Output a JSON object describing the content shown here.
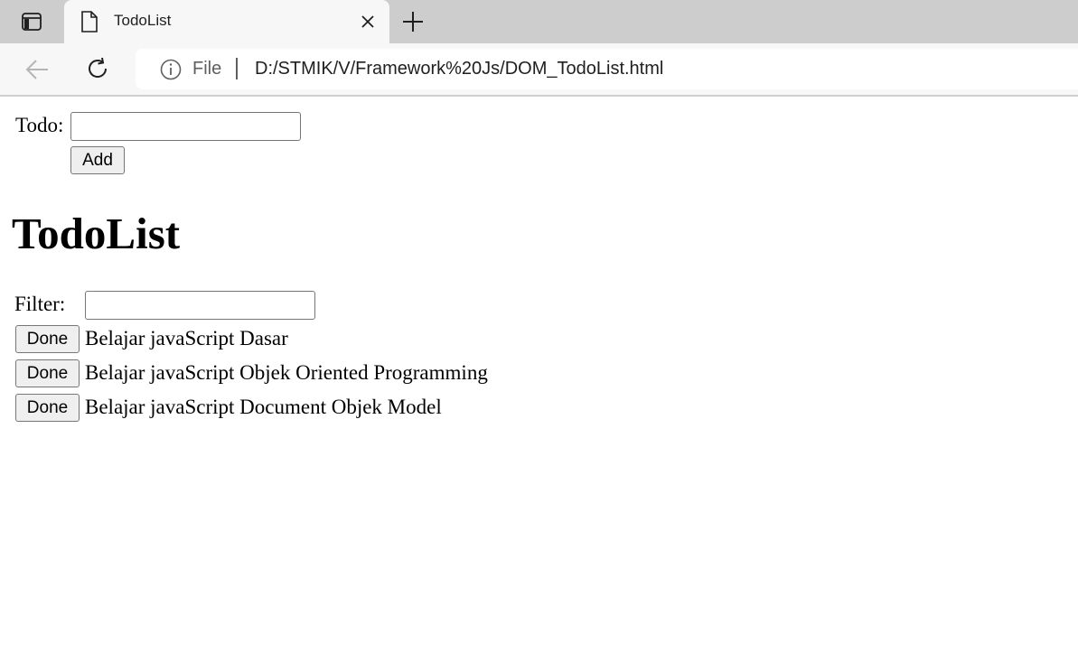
{
  "browser": {
    "tab": {
      "title": "TodoList"
    },
    "address_bar": {
      "scheme_label": "File",
      "url": "D:/STMIK/V/Framework%20Js/DOM_TodoList.html"
    }
  },
  "page": {
    "todo_label": "Todo:",
    "todo_input_value": "",
    "add_button": "Add",
    "heading": "TodoList",
    "filter_label": "Filter:",
    "filter_input_value": "",
    "todos": [
      {
        "done_label": "Done",
        "text": "Belajar javaScript Dasar"
      },
      {
        "done_label": "Done",
        "text": "Belajar javaScript Objek Oriented Programming"
      },
      {
        "done_label": "Done",
        "text": "Belajar javaScript Document Objek Model"
      }
    ]
  }
}
